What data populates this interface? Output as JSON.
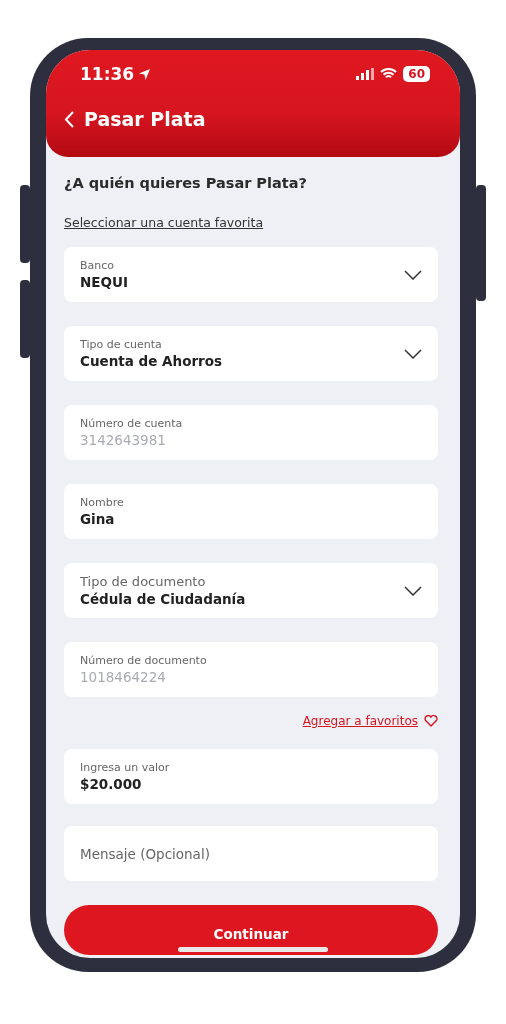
{
  "status_bar": {
    "time": "11:36",
    "battery": "60"
  },
  "header": {
    "title": "Pasar Plata"
  },
  "question": "¿A quién quieres Pasar Plata?",
  "favorite_link": "Seleccionar una cuenta favorita",
  "fields": [
    {
      "kind": "select",
      "label": "Banco",
      "value": "NEQUI",
      "disabled": false
    },
    {
      "kind": "select",
      "label": "Tipo de cuenta",
      "value": "Cuenta de Ahorros",
      "disabled": false
    },
    {
      "kind": "text",
      "label": "Número de cuenta",
      "value": "3142643981",
      "disabled": true
    },
    {
      "kind": "text",
      "label": "Nombre",
      "value": "Gina",
      "disabled": false
    },
    {
      "kind": "select",
      "label": "Tipo de documento",
      "value": "Cédula de Ciudadanía",
      "disabled": false
    },
    {
      "kind": "text",
      "label": "Número de documento",
      "value": "1018464224",
      "disabled": true
    }
  ],
  "add_favorite": "Agregar a favoritos",
  "amount": {
    "label": "Ingresa un valor",
    "value": "$20.000"
  },
  "message": {
    "placeholder": "Mensaje (Opcional)"
  },
  "continue_button": "Continuar"
}
